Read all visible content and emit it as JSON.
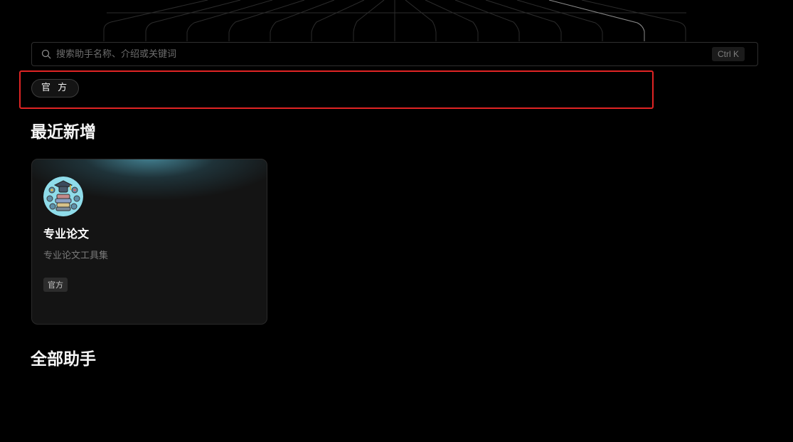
{
  "search": {
    "placeholder": "搜索助手名称、介绍或关键词",
    "value": "",
    "shortcut": "Ctrl K"
  },
  "filters": [
    {
      "label": "官 方"
    }
  ],
  "sections": {
    "recent_title": "最近新增",
    "all_title": "全部助手"
  },
  "recent_cards": [
    {
      "name": "专业论文",
      "description": "专业论文工具集",
      "tag": "官方",
      "icon": "graduation-books-icon"
    }
  ],
  "colors": {
    "background": "#000000",
    "highlight": "#e02424",
    "card_glow": "#4c96aa"
  }
}
